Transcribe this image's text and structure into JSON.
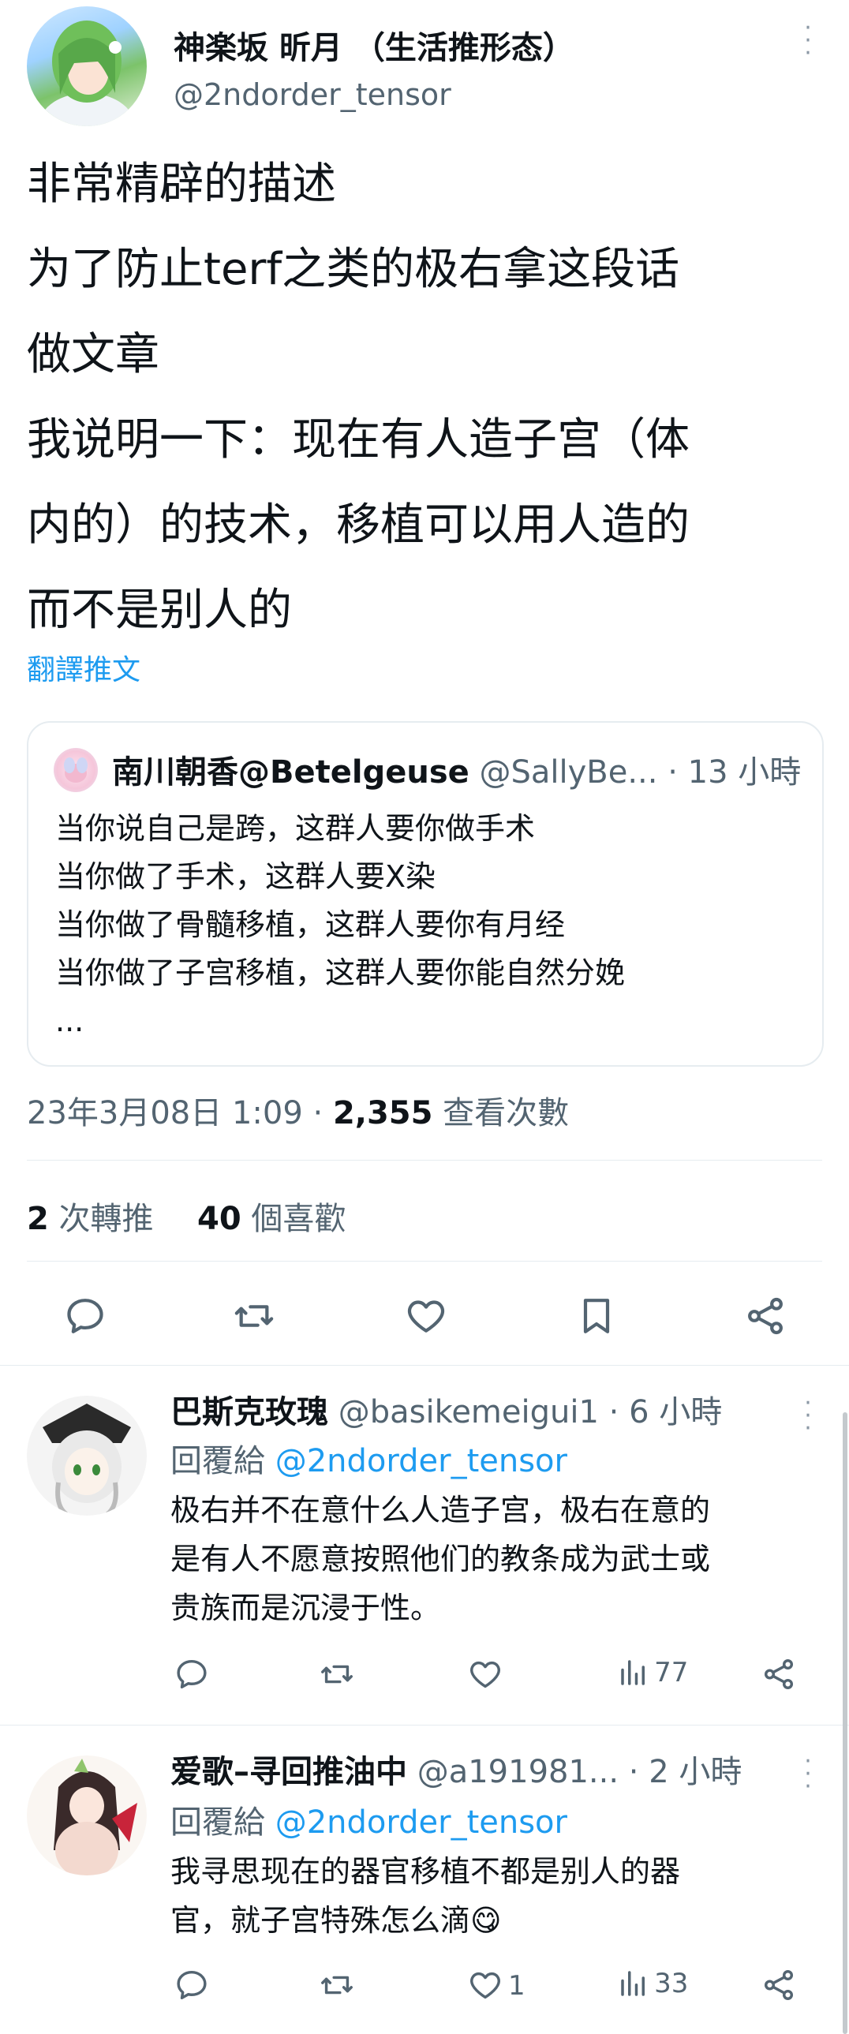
{
  "author": {
    "display_name": "神楽坂 昕月 （生活推形态）",
    "handle": "@2ndorder_tensor"
  },
  "tweet": {
    "lines": [
      "非常精辟的描述",
      "为了防止terf之类的极右拿这段话",
      "做文章",
      "我说明一下：现在有人造子宫（体",
      "内的）的技术，移植可以用人造的",
      "而不是别人的"
    ],
    "translate_label": "翻譯推文"
  },
  "quote": {
    "display_name": "南川朝香@Betelgeuse",
    "handle": "@SallyBe...",
    "time": "· 13 小時",
    "lines": [
      "当你说自己是跨，这群人要你做手术",
      "当你做了手术，这群人要X染",
      "当你做了骨髓移植，这群人要你有月经",
      "当你做了子宫移植，这群人要你能自然分娩",
      "..."
    ]
  },
  "meta": {
    "timestamp": "23年3月08日 1:09 · ",
    "views_count": "2,355",
    "views_label": " 查看次數"
  },
  "stats": {
    "retweets_count": "2",
    "retweets_label": " 次轉推",
    "likes_count": "40",
    "likes_label": " 個喜歡"
  },
  "replies": [
    {
      "display_name": "巴斯克玫瑰",
      "handle": "@basikemeigui1",
      "time": "· 6 小時",
      "reply_to_label": "回覆給",
      "reply_to_handle": "@2ndorder_tensor",
      "lines": [
        "极右并不在意什么人造子宫，极右在意的",
        "是有人不愿意按照他们的教条成为武士或",
        "贵族而是沉浸于性。"
      ],
      "like_count": "",
      "views": "77"
    },
    {
      "display_name": "爱歌–寻回推油中",
      "handle": "@a191981...",
      "time": "· 2 小時",
      "reply_to_label": "回覆給",
      "reply_to_handle": "@2ndorder_tensor",
      "lines": [
        "我寻思现在的器官移植不都是别人的器",
        "官，就子宫特殊怎么滴😋"
      ],
      "like_count": "1",
      "views": "33"
    }
  ],
  "colors": {
    "accent": "#1d9bf0",
    "text": "#0f1419",
    "muted": "#536471",
    "border": "#e6ecf0"
  }
}
